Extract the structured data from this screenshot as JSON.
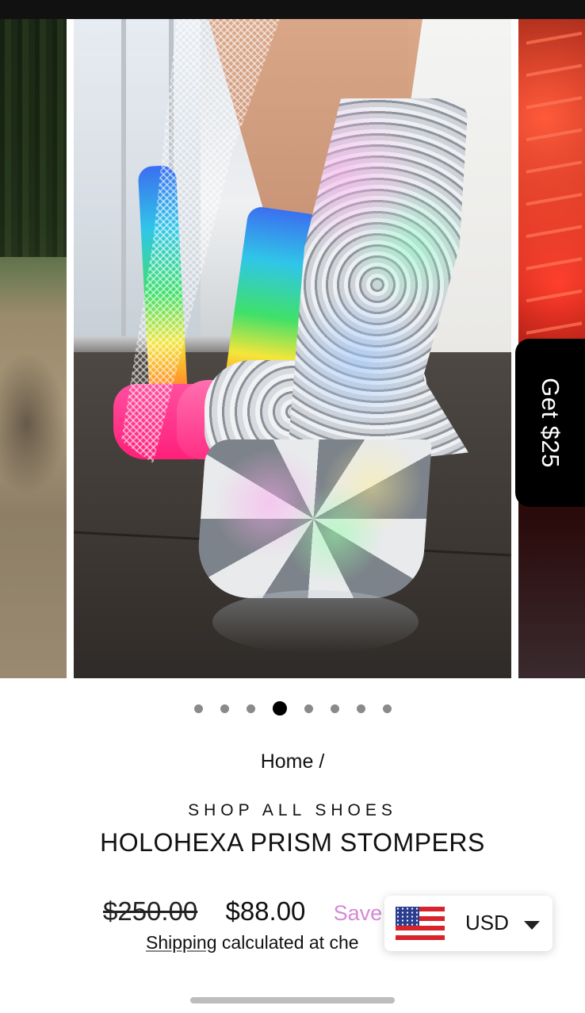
{
  "promo": {
    "label": "Get $25"
  },
  "carousel": {
    "slide_count": 8,
    "active_index": 3
  },
  "breadcrumb": {
    "home": "Home",
    "separator": "/"
  },
  "product": {
    "collection": "SHOP ALL SHOES",
    "title": "HOLOHEXA PRISM STOMPERS",
    "compare_price": "$250.00",
    "price": "$88.00",
    "save_label": "Save",
    "shipping_link": "Shipping",
    "shipping_text": "calculated at che"
  },
  "currency": {
    "code": "USD",
    "flag_icon": "us-flag-icon"
  },
  "colors": {
    "accent_save": "#d58ad6",
    "promo_bg": "#000000"
  }
}
